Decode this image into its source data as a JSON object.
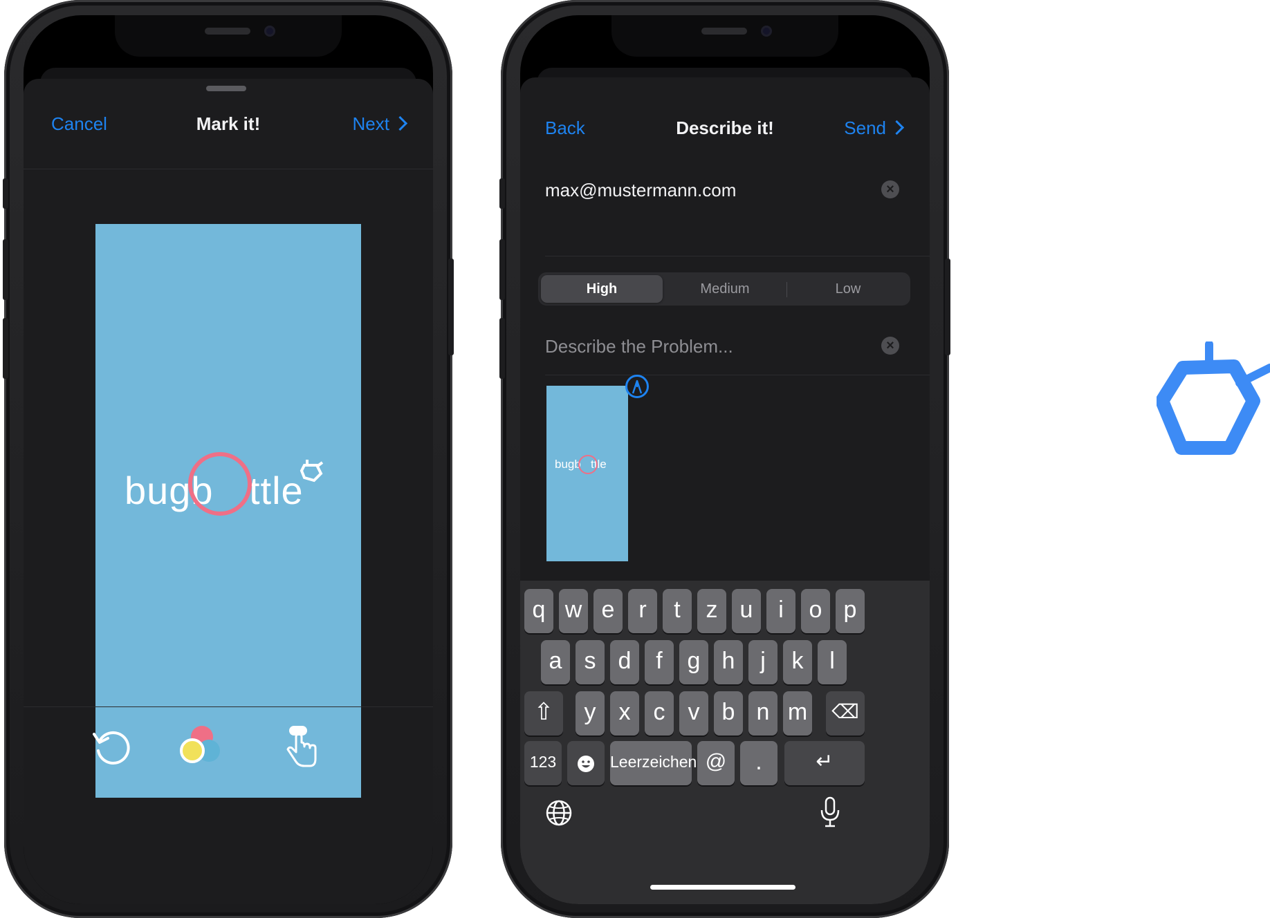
{
  "phone1": {
    "nav": {
      "cancel_label": "Cancel",
      "title": "Mark it!",
      "next_label": "Next"
    },
    "preview": {
      "logo_text_left": "bugb",
      "logo_text_right": "ttle"
    },
    "toolbar": {
      "undo_icon": "undo-icon",
      "color_icon": "color-picker-icon",
      "mode_icon": "tap-gesture-icon"
    }
  },
  "phone2": {
    "nav": {
      "back_label": "Back",
      "title": "Describe it!",
      "send_label": "Send"
    },
    "email": {
      "value": "max@mustermann.com"
    },
    "priority": {
      "options": [
        "High",
        "Medium",
        "Low"
      ],
      "selected": "High"
    },
    "description": {
      "placeholder": "Describe the Problem..."
    },
    "thumbnail": {
      "logo_text_left": "bugb",
      "logo_text_right": "ttle"
    },
    "keyboard": {
      "row1": [
        "q",
        "w",
        "e",
        "r",
        "t",
        "z",
        "u",
        "i",
        "o",
        "p"
      ],
      "row2": [
        "a",
        "s",
        "d",
        "f",
        "g",
        "h",
        "j",
        "k",
        "l"
      ],
      "row3": [
        "y",
        "x",
        "c",
        "v",
        "b",
        "n",
        "m"
      ],
      "numbers_label": "123",
      "space_label": "Leerzeichen",
      "at_label": "@",
      "dot_label": ".",
      "return_label": "↵",
      "shift_label": "⇧",
      "delete_label": "⌫"
    }
  },
  "colors": {
    "accent": "#1e83f0",
    "sheet": "#1c1c1e",
    "preview_blue": "#73b8da",
    "marker_red": "#ef6f86",
    "brand_blue": "#3d8bf5"
  }
}
